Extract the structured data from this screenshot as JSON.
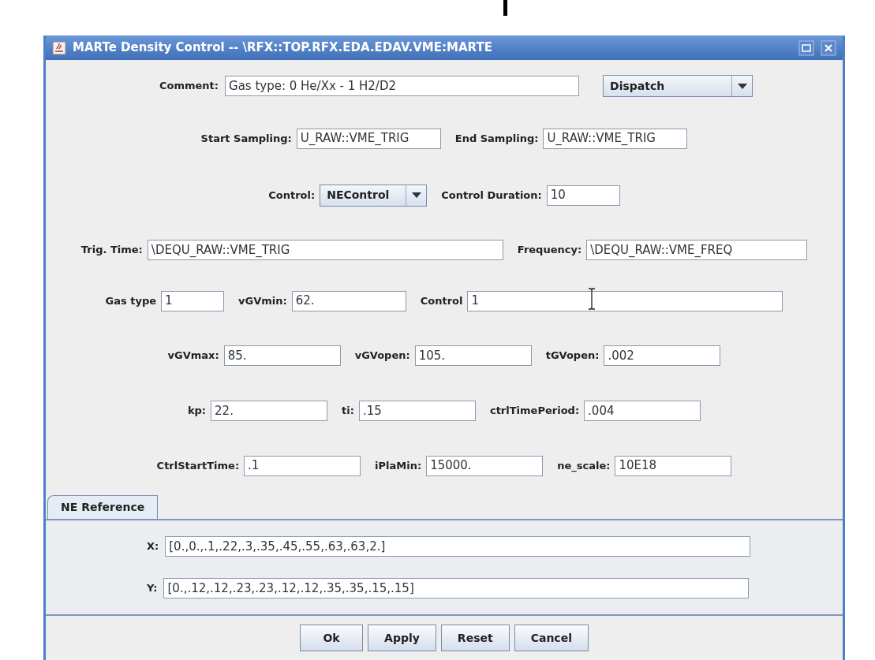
{
  "window": {
    "title": "MARTe Density Control -- \\RFX::TOP.RFX.EDA.EDAV.VME:MARTE"
  },
  "comment": {
    "label": "Comment:",
    "value": "Gas type: 0 He/Xx - 1 H2/D2",
    "dropdown": "Dispatch"
  },
  "rows": [
    {
      "fields": [
        {
          "kind": "text",
          "label": "Start Sampling:",
          "value": "U_RAW::VME_TRIG"
        },
        {
          "kind": "text",
          "label": "End Sampling:",
          "value": "U_RAW::VME_TRIG"
        }
      ]
    },
    {
      "fields": [
        {
          "kind": "combo",
          "label": "Control:",
          "value": "NEControl"
        },
        {
          "kind": "text",
          "label": "Control Duration:",
          "value": "10"
        }
      ]
    },
    {
      "fields": [
        {
          "kind": "text",
          "label": "Trig. Time:",
          "value": "\\DEQU_RAW::VME_TRIG"
        },
        {
          "kind": "text",
          "label": "Frequency:",
          "value": "\\DEQU_RAW::VME_FREQ"
        }
      ]
    },
    {
      "fields": [
        {
          "kind": "text",
          "label": "Gas type",
          "value": "1"
        },
        {
          "kind": "text",
          "label": "vGVmin:",
          "value": "62."
        },
        {
          "kind": "text",
          "label": "Control",
          "value": "1"
        }
      ]
    },
    {
      "fields": [
        {
          "kind": "text",
          "label": "vGVmax:",
          "value": "85."
        },
        {
          "kind": "text",
          "label": "vGVopen:",
          "value": "105."
        },
        {
          "kind": "text",
          "label": "tGVopen:",
          "value": ".002"
        }
      ]
    },
    {
      "fields": [
        {
          "kind": "text",
          "label": "kp:",
          "value": "22."
        },
        {
          "kind": "text",
          "label": "ti:",
          "value": ".15"
        },
        {
          "kind": "text",
          "label": "ctrlTimePeriod:",
          "value": ".004"
        }
      ]
    },
    {
      "fields": [
        {
          "kind": "text",
          "label": "CtrlStartTime:",
          "value": ".1"
        },
        {
          "kind": "text",
          "label": "iPlaMin:",
          "value": "15000."
        },
        {
          "kind": "text",
          "label": "ne_scale:",
          "value": "10E18"
        }
      ]
    }
  ],
  "tabs": [
    {
      "label": "NE Reference",
      "selected": true
    }
  ],
  "reference": [
    {
      "label": "X:",
      "value": "[0.,0.,.1,.22,.3,.35,.45,.55,.63,.63,2.]"
    },
    {
      "label": "Y:",
      "value": "[0.,.12,.12,.23,.23,.12,.12,.35,.35,.15,.15]"
    }
  ],
  "buttons": [
    "Ok",
    "Apply",
    "Reset",
    "Cancel"
  ]
}
